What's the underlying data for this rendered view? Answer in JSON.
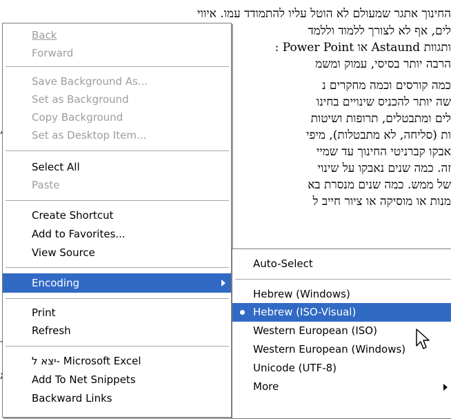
{
  "background_text": {
    "lines": [
      "החינוך אתגר שמעולם לא הוטל עליו להתמודד עמו. איווי",
      "לים, אף לא לצורך ללמוד וללמד",
      "ותגוות Astaund או Power Point : ",
      "הרבה יותר בסיסי, עמוק ומשמ",
      "כמה קורסים וכמה מחקרים נ",
      "שה יותר להכניס שינויים בחינו",
      "לים ומתבטלים, תרופות ושיטות",
      "ות (סליחה, לא מתבטלות), מיפי",
      "אבקו קברניטי החינוך עד שמיי",
      "זה. כמה שנים נאבקו על שינוי",
      "של ממש. כמה שנים מנסרת בא",
      "מנות או מוסיקה או ציור חייב ל"
    ],
    "left_edge_marks": [
      ",",
      "-",
      ";"
    ]
  },
  "context_menu": {
    "items": [
      {
        "label": "Back",
        "disabled": true
      },
      {
        "label": "Forward",
        "disabled": true
      },
      {
        "label": "Save Background As...",
        "disabled": true
      },
      {
        "label": "Set as Background",
        "disabled": true
      },
      {
        "label": "Copy Background",
        "disabled": true
      },
      {
        "label": "Set as Desktop Item...",
        "disabled": true
      },
      {
        "label": "Select All",
        "disabled": false
      },
      {
        "label": "Paste",
        "disabled": true
      },
      {
        "label": "Create Shortcut",
        "disabled": false
      },
      {
        "label": "Add to Favorites...",
        "disabled": false
      },
      {
        "label": "View Source",
        "disabled": false
      },
      {
        "label": "Encoding",
        "disabled": false,
        "highlighted": true,
        "has_submenu": true
      },
      {
        "label": "Print",
        "disabled": false
      },
      {
        "label": "Refresh",
        "disabled": false
      },
      {
        "label": "יצא ל- Microsoft Excel",
        "disabled": false
      },
      {
        "label": "Add To Net Snippets",
        "disabled": false
      },
      {
        "label": "Backward Links",
        "disabled": false
      }
    ]
  },
  "encoding_submenu": {
    "items": [
      {
        "label": "Auto-Select"
      },
      {
        "label": "Hebrew (Windows)"
      },
      {
        "label": "Hebrew (ISO-Visual)",
        "selected": true,
        "highlighted": true
      },
      {
        "label": "Western European (ISO)"
      },
      {
        "label": "Western European (Windows)"
      },
      {
        "label": "Unicode (UTF-8)"
      },
      {
        "label": "More",
        "has_submenu": true
      }
    ]
  },
  "colors": {
    "highlight": "#316ac5",
    "disabled_text": "#9d9d9d",
    "menu_border": "#7a7a7a"
  }
}
